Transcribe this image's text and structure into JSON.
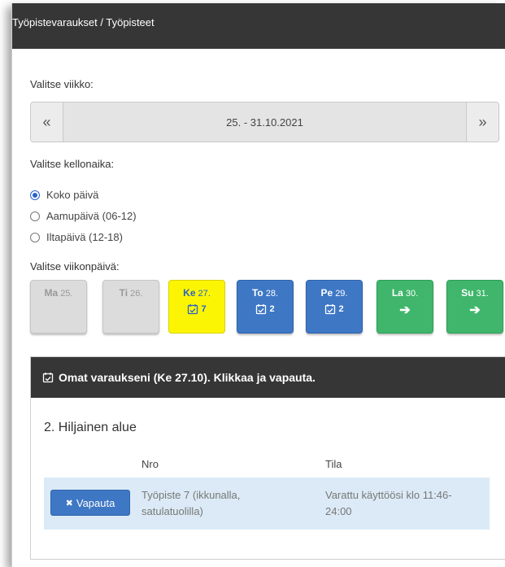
{
  "breadcrumb": "Työpistevaraukset / Työpisteet",
  "week": {
    "label": "Valitse viikko:",
    "prev": "«",
    "range": "25. - 31.10.2021",
    "next": "»"
  },
  "time": {
    "label": "Valitse kellonaika:",
    "options": [
      {
        "label": "Koko päivä",
        "checked": true
      },
      {
        "label": "Aamupäivä (06-12)",
        "checked": false
      },
      {
        "label": "Iltapäivä (12-18)",
        "checked": false
      }
    ]
  },
  "weekday": {
    "label": "Valitse viikonpäivä:",
    "days": [
      {
        "name": "Ma",
        "date": "25.",
        "count": "",
        "state": "disabled"
      },
      {
        "name": "Ti",
        "date": "26.",
        "count": "",
        "state": "disabled"
      },
      {
        "name": "Ke",
        "date": "27.",
        "count": "7",
        "state": "selected"
      },
      {
        "name": "To",
        "date": "28.",
        "count": "2",
        "state": "blue"
      },
      {
        "name": "Pe",
        "date": "29.",
        "count": "2",
        "state": "blue"
      },
      {
        "name": "La",
        "date": "30.",
        "count": "",
        "state": "green"
      },
      {
        "name": "Su",
        "date": "31.",
        "count": "",
        "state": "green"
      }
    ]
  },
  "reservations": {
    "header": "Omat varaukseni (Ke 27.10). Klikkaa ja vapauta.",
    "area": "2. Hiljainen alue",
    "col_nro": "Nro",
    "col_tila": "Tila",
    "row": {
      "button": "Vapauta",
      "nro_line1": "Työpiste 7 (ikkunalla,",
      "nro_line2": "satulatuolilla)",
      "tila_line1": "Varattu käyttöösi klo 11:46-",
      "tila_line2": "24:00"
    }
  },
  "colors": {
    "selected": "#fbf504",
    "blue": "#3e77c4",
    "green": "#3fb66b",
    "header": "#363636"
  }
}
